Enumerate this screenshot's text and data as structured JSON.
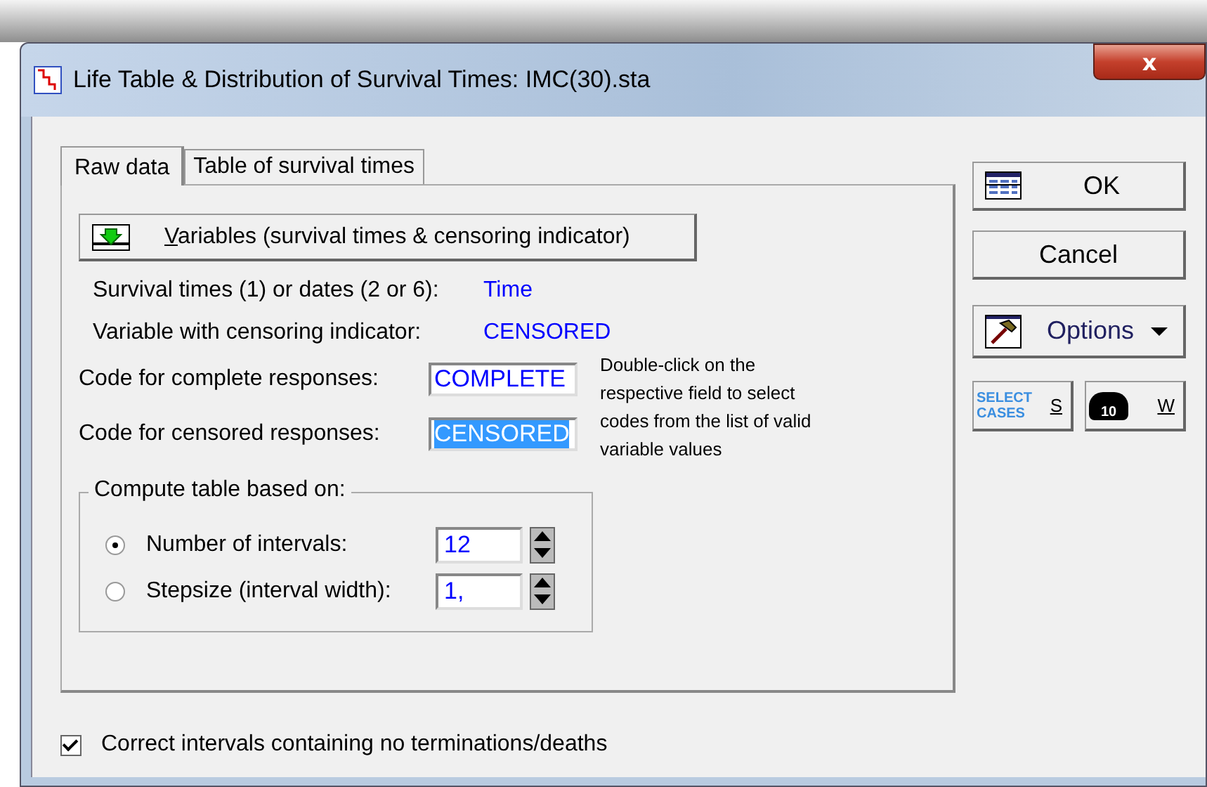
{
  "window": {
    "title": "Life Table & Distribution of Survival Times: IMC(30).sta",
    "close": "x"
  },
  "tabs": [
    {
      "label": "Raw data",
      "selected": true
    },
    {
      "label": "Table of survival times",
      "selected": false
    }
  ],
  "variables_button": "Variables (survival times & censoring indicator)",
  "info": [
    {
      "label": "Survival times (1) or dates (2 or 6):",
      "value": "Time"
    },
    {
      "label": "Variable with censoring indicator:",
      "value": "CENSORED"
    }
  ],
  "codes": [
    {
      "label": "Code for complete responses:",
      "value": "COMPLETE",
      "selected": false
    },
    {
      "label": "Code for censored responses:",
      "value": "CENSORED",
      "selected": true
    }
  ],
  "hint": "Double-click on the respective field to select codes from the list of valid variable values",
  "compute_group": {
    "title": "Compute table based on:",
    "options": [
      {
        "label": "Number of intervals:",
        "value": "12",
        "selected": true
      },
      {
        "label": "Stepsize (interval width):",
        "value": "1,",
        "selected": false
      }
    ]
  },
  "buttons": [
    {
      "kind": "ok",
      "label": "OK"
    },
    {
      "kind": "cancel",
      "label": "Cancel"
    },
    {
      "kind": "options",
      "label": "Options"
    }
  ],
  "small_buttons": [
    {
      "kind": "select",
      "icon_text": "SELECT CASES",
      "label": "S"
    },
    {
      "kind": "weight",
      "icon_text": "10",
      "label": "W"
    }
  ],
  "correct_checkbox": {
    "label": "Correct intervals containing no terminations/deaths",
    "checked": true
  }
}
